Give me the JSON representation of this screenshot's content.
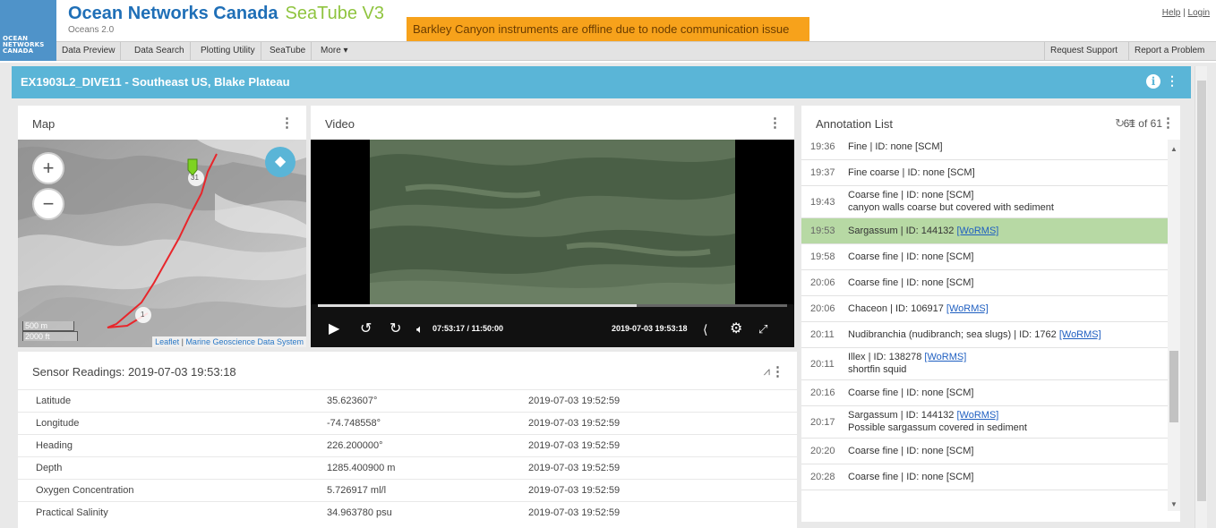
{
  "header": {
    "logo_text": "OCEAN\nNETWORKS\nCANADA",
    "brand": "Ocean Networks Canada",
    "app": "SeaTube V3",
    "brand_small": "Oceans 2.0",
    "banner": "Barkley Canyon instruments are offline due to node communication issue",
    "help": "Help",
    "login": "Login",
    "separator": "|"
  },
  "nav": {
    "items": [
      "Data Preview",
      "Data Search",
      "Plotting Utility",
      "SeaTube",
      "More ▾"
    ],
    "right": [
      "Request Support",
      "Report a Problem"
    ]
  },
  "titlebar": {
    "title": "EX1903L2_DIVE11 - Southeast US, Blake Plateau"
  },
  "map": {
    "title": "Map",
    "zoom_in": "+",
    "zoom_out": "−",
    "scale_m": "500 m",
    "scale_ft": "2000 ft",
    "attrib_leaflet": "Leaflet",
    "attrib_sep": " | ",
    "attrib_src": "Marine Geoscience Data System",
    "marker_start": "1",
    "marker_end": "31"
  },
  "video": {
    "title": "Video",
    "time": "07:53:17 / 11:50:00",
    "date": "2019-07-03 19:53:18",
    "progress": 0.68
  },
  "annotations": {
    "title": "Annotation List",
    "count": "61 of 61",
    "items": [
      {
        "time": "19:36",
        "text": "Fine | ID: none [SCM]"
      },
      {
        "time": "19:37",
        "text": "Fine coarse | ID: none [SCM]"
      },
      {
        "time": "19:43",
        "text": "Coarse fine | ID: none [SCM]",
        "note": "canyon walls coarse but covered with sediment"
      },
      {
        "time": "19:53",
        "text": "Sargassum | ID: 144132 ",
        "link": "[WoRMS]",
        "selected": true
      },
      {
        "time": "19:58",
        "text": "Coarse fine | ID: none [SCM]"
      },
      {
        "time": "20:06",
        "text": "Coarse fine | ID: none [SCM]"
      },
      {
        "time": "20:06",
        "text": "Chaceon | ID: 106917 ",
        "link": "[WoRMS]"
      },
      {
        "time": "20:11",
        "text": "Nudibranchia (nudibranch; sea slugs) | ID: 1762 ",
        "link": "[WoRMS]"
      },
      {
        "time": "20:11",
        "text": "Illex | ID: 138278 ",
        "link": "[WoRMS]",
        "note": "shortfin squid"
      },
      {
        "time": "20:16",
        "text": "Coarse fine | ID: none [SCM]"
      },
      {
        "time": "20:17",
        "text": "Sargassum | ID: 144132 ",
        "link": "[WoRMS]",
        "note": "Possible sargassum covered in sediment"
      },
      {
        "time": "20:20",
        "text": "Coarse fine | ID: none [SCM]"
      },
      {
        "time": "20:28",
        "text": "Coarse fine | ID: none [SCM]"
      }
    ]
  },
  "sensor": {
    "title": "Sensor Readings: 2019-07-03 19:53:18",
    "rows": [
      {
        "name": "Latitude",
        "value": "35.623607°",
        "time": "2019-07-03 19:52:59"
      },
      {
        "name": "Longitude",
        "value": "-74.748558°",
        "time": "2019-07-03 19:52:59"
      },
      {
        "name": "Heading",
        "value": "226.200000°",
        "time": "2019-07-03 19:52:59"
      },
      {
        "name": "Depth",
        "value": "1285.400900 m",
        "time": "2019-07-03 19:52:59"
      },
      {
        "name": "Oxygen Concentration",
        "value": "5.726917 ml/l",
        "time": "2019-07-03 19:52:59"
      },
      {
        "name": "Practical Salinity",
        "value": "34.963780 psu",
        "time": "2019-07-03 19:52:59"
      }
    ]
  },
  "colors": {
    "accent": "#5ab5d7",
    "brand_blue": "#1f6fb7",
    "brand_green": "#8fc43f",
    "banner": "#f7a21b",
    "selected_row": "#b7d9a4",
    "track": "#e8262b"
  }
}
